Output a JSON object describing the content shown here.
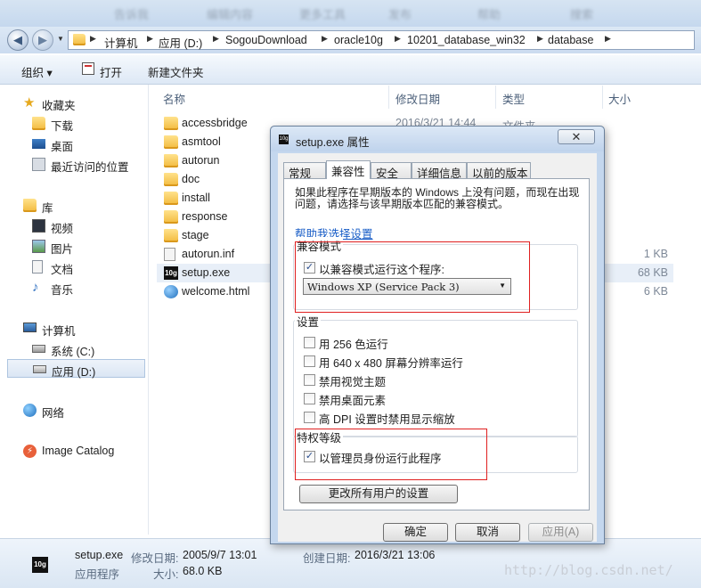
{
  "address": {
    "crumbs": [
      "计算机",
      "应用 (D:)",
      "SogouDownload",
      "oracle10g",
      "10201_database_win32",
      "database"
    ]
  },
  "toolbar": {
    "organize": "组织 ▾",
    "open": "打开",
    "new_folder": "新建文件夹"
  },
  "sidebar": {
    "favorites": {
      "label": "收藏夹",
      "items": [
        "下载",
        "桌面",
        "最近访问的位置"
      ]
    },
    "library": {
      "label": "库",
      "items": [
        "视频",
        "图片",
        "文档",
        "音乐"
      ]
    },
    "computer": {
      "label": "计算机",
      "items": [
        "系统 (C:)",
        "应用 (D:)"
      ]
    },
    "network": "网络",
    "image_catalog": "Image Catalog"
  },
  "columns": {
    "name": "名称",
    "date": "修改日期",
    "type": "类型",
    "size": "大小"
  },
  "files": [
    {
      "name": "accessbridge",
      "date": "2016/3/21 14:44",
      "type": "文件夹",
      "size": ""
    },
    {
      "name": "asmtool",
      "date": "",
      "type": "",
      "size": ""
    },
    {
      "name": "autorun",
      "date": "",
      "type": "",
      "size": ""
    },
    {
      "name": "doc",
      "date": "",
      "type": "",
      "size": ""
    },
    {
      "name": "install",
      "date": "",
      "type": "",
      "size": ""
    },
    {
      "name": "response",
      "date": "",
      "type": "",
      "size": ""
    },
    {
      "name": "stage",
      "date": "",
      "type": "",
      "size": ""
    },
    {
      "name": "autorun.inf",
      "date": "",
      "type": "",
      "size": "1 KB"
    },
    {
      "name": "setup.exe",
      "date": "",
      "type": "",
      "size": "68 KB"
    },
    {
      "name": "welcome.html",
      "date": "",
      "type": "",
      "size": "6 KB"
    }
  ],
  "status": {
    "file": "setup.exe",
    "modified_label": "修改日期:",
    "modified": "2005/9/7 13:01",
    "created_label": "创建日期:",
    "created": "2016/3/21 13:06",
    "type": "应用程序",
    "size_label": "大小:",
    "size": "68.0 KB",
    "icon_text": "10g"
  },
  "dialog": {
    "title": "setup.exe 属性",
    "tabs": [
      "常规",
      "兼容性",
      "安全",
      "详细信息",
      "以前的版本"
    ],
    "selected_tab": "兼容性",
    "description": "如果此程序在早期版本的 Windows 上没有问题，而现在出现问题，请选择与该早期版本匹配的兼容模式。",
    "help_link": "帮助我选择设置",
    "compat_group": "兼容模式",
    "compat_check": "以兼容模式运行这个程序:",
    "compat_select": "Windows XP (Service Pack 3)",
    "settings_group": "设置",
    "settings": [
      "用 256 色运行",
      "用 640 x 480 屏幕分辨率运行",
      "禁用视觉主题",
      "禁用桌面元素",
      "高 DPI 设置时禁用显示缩放"
    ],
    "privilege_group": "特权等级",
    "privilege_check": "以管理员身份运行此程序",
    "all_users_button": "更改所有用户的设置",
    "ok": "确定",
    "cancel": "取消",
    "apply": "应用(A)",
    "close_glyph": "✕",
    "check_glyph": "✓",
    "exe_icon_text": "10g"
  },
  "watermark": "http://blog.csdn.net/",
  "background_tabs": [
    "告诉我",
    "编辑内容",
    "更多工具",
    "发布",
    "帮助",
    "搜索"
  ]
}
